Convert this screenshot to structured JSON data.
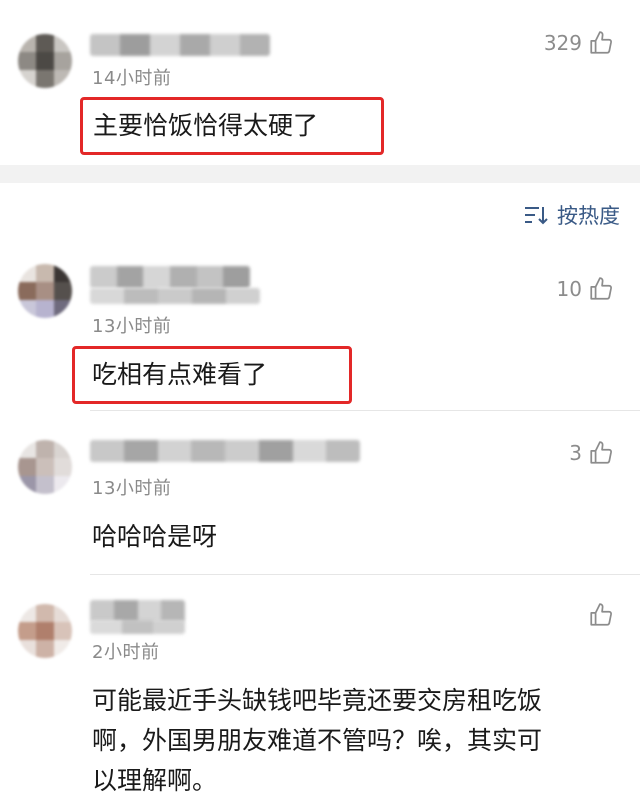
{
  "sort": {
    "label": "按热度",
    "icon": "sort-icon"
  },
  "comments": [
    {
      "time": "14小时前",
      "likes": "329",
      "text": "主要恰饭恰得太硬了",
      "highlighted": true
    },
    {
      "time": "13小时前",
      "likes": "10",
      "text": "吃相有点难看了",
      "highlighted": true
    },
    {
      "time": "13小时前",
      "likes": "3",
      "text": "哈哈哈是呀",
      "highlighted": false
    },
    {
      "time": "2小时前",
      "likes": "",
      "text_lines": [
        "可能最近手头缺钱吧毕竟还要交房租吃饭",
        "啊，外国男朋友难道不管吗？唉，其实可",
        "以理解啊。"
      ],
      "highlighted": false
    }
  ],
  "colors": {
    "highlight": "#e32828",
    "sort_text": "#3a5a86",
    "muted": "#8a8a8a"
  }
}
